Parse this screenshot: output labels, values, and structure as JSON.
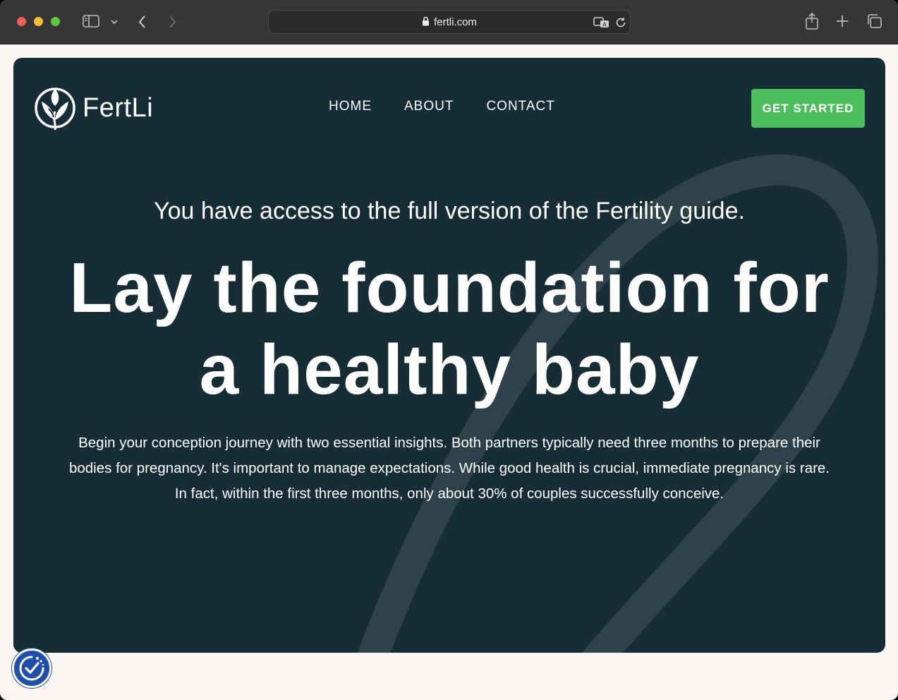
{
  "browser": {
    "url": "fertli.com",
    "icons": [
      "sidebar-icon",
      "chevron-down-icon",
      "back-icon",
      "forward-icon",
      "lock-icon",
      "translate-icon",
      "reload-icon",
      "share-icon",
      "new-tab-icon",
      "tabs-overview-icon"
    ]
  },
  "header": {
    "logo_text": "FertLi",
    "nav": [
      "HOME",
      "ABOUT",
      "CONTACT"
    ],
    "cta_label": "GET STARTED"
  },
  "hero": {
    "subheading": "You have access to the full version of the Fertility guide.",
    "headline_line1": "Lay the foundation for",
    "headline_line2": "a healthy baby",
    "body": "Begin your conception journey with two essential insights. Both partners typically need three months to prepare their bodies for pregnancy. It's important to manage expectations. While good health is crucial, immediate pregnancy is rare. In fact, within the first three months, only about 30% of couples successfully conceive."
  },
  "accessibility": {
    "icon": "accessibility-icon"
  },
  "colors": {
    "hero_bg": "#172d35",
    "cta_green": "#4cbe5b",
    "page_bg": "#f8f5f2",
    "chrome_bg": "#363636"
  }
}
